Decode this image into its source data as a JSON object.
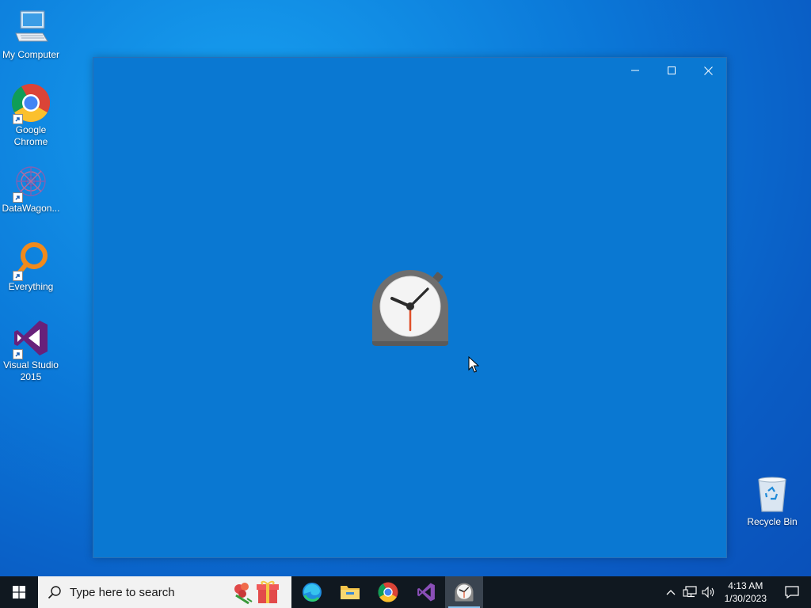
{
  "desktop": {
    "icons": [
      {
        "label": "My Computer",
        "icon": "computer-icon"
      },
      {
        "label": "Google Chrome",
        "icon": "chrome-icon"
      },
      {
        "label": "DataWagon...",
        "icon": "datawagon-icon"
      },
      {
        "label": "Everything",
        "icon": "everything-search-icon"
      },
      {
        "label": "Visual Studio 2015",
        "icon": "visual-studio-icon"
      },
      {
        "label": "Recycle Bin",
        "icon": "recycle-bin-icon"
      }
    ]
  },
  "window": {
    "controls": [
      "minimize",
      "maximize",
      "close"
    ],
    "splash_icon": "alarm-clock-icon"
  },
  "taskbar": {
    "search_placeholder": "Type here to search",
    "apps": [
      {
        "name": "Microsoft Edge",
        "icon": "edge-icon",
        "active": false
      },
      {
        "name": "File Explorer",
        "icon": "file-explorer-icon",
        "active": false
      },
      {
        "name": "Google Chrome",
        "icon": "chrome-icon",
        "active": false
      },
      {
        "name": "Visual Studio",
        "icon": "visual-studio-icon",
        "active": false
      },
      {
        "name": "Alarms & Clock",
        "icon": "alarm-clock-icon",
        "active": true
      }
    ],
    "clock": {
      "time": "4:13 AM",
      "date": "1/30/2023"
    }
  },
  "colors": {
    "window_bg": "#0a78d2",
    "taskbar_bg": "#101820",
    "accent": "#0078d7"
  }
}
